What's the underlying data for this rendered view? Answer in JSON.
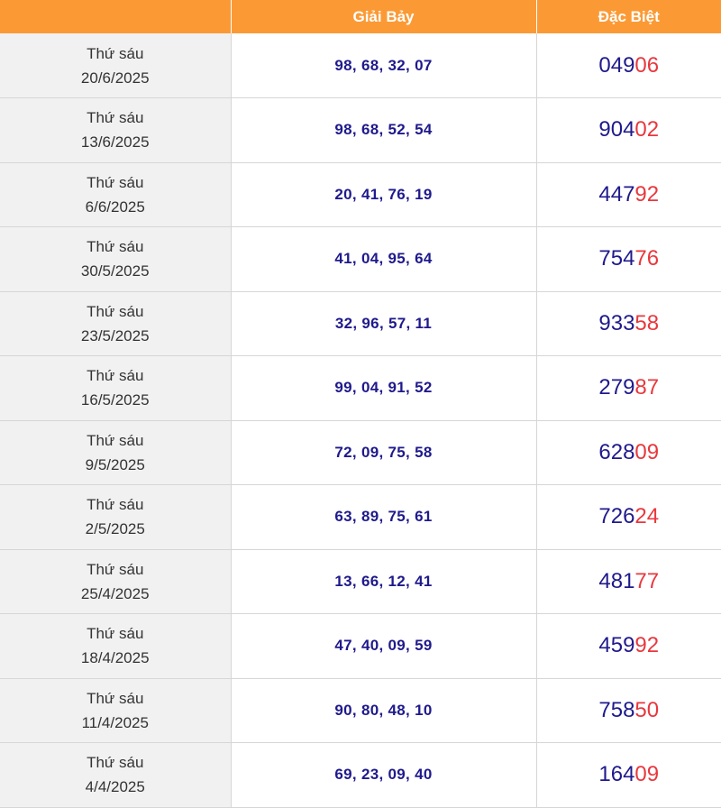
{
  "header": {
    "col_date": "",
    "col_seven": "Giải Bảy",
    "col_special": "Đặc Biệt"
  },
  "colors": {
    "header_bg": "#fb9a35",
    "number_blue": "#1f1a8c",
    "number_red": "#e8383d",
    "date_bg": "#f1f1f1"
  },
  "rows": [
    {
      "weekday": "Thứ sáu",
      "date": "20/6/2025",
      "seven": "98, 68, 32, 07",
      "special_head": "049",
      "special_tail": "06"
    },
    {
      "weekday": "Thứ sáu",
      "date": "13/6/2025",
      "seven": "98, 68, 52, 54",
      "special_head": "904",
      "special_tail": "02"
    },
    {
      "weekday": "Thứ sáu",
      "date": "6/6/2025",
      "seven": "20, 41, 76, 19",
      "special_head": "447",
      "special_tail": "92"
    },
    {
      "weekday": "Thứ sáu",
      "date": "30/5/2025",
      "seven": "41, 04, 95, 64",
      "special_head": "754",
      "special_tail": "76"
    },
    {
      "weekday": "Thứ sáu",
      "date": "23/5/2025",
      "seven": "32, 96, 57, 11",
      "special_head": "933",
      "special_tail": "58"
    },
    {
      "weekday": "Thứ sáu",
      "date": "16/5/2025",
      "seven": "99, 04, 91, 52",
      "special_head": "279",
      "special_tail": "87"
    },
    {
      "weekday": "Thứ sáu",
      "date": "9/5/2025",
      "seven": "72, 09, 75, 58",
      "special_head": "628",
      "special_tail": "09"
    },
    {
      "weekday": "Thứ sáu",
      "date": "2/5/2025",
      "seven": "63, 89, 75, 61",
      "special_head": "726",
      "special_tail": "24"
    },
    {
      "weekday": "Thứ sáu",
      "date": "25/4/2025",
      "seven": "13, 66, 12, 41",
      "special_head": "481",
      "special_tail": "77"
    },
    {
      "weekday": "Thứ sáu",
      "date": "18/4/2025",
      "seven": "47, 40, 09, 59",
      "special_head": "459",
      "special_tail": "92"
    },
    {
      "weekday": "Thứ sáu",
      "date": "11/4/2025",
      "seven": "90, 80, 48, 10",
      "special_head": "758",
      "special_tail": "50"
    },
    {
      "weekday": "Thứ sáu",
      "date": "4/4/2025",
      "seven": "69, 23, 09, 40",
      "special_head": "164",
      "special_tail": "09"
    }
  ]
}
